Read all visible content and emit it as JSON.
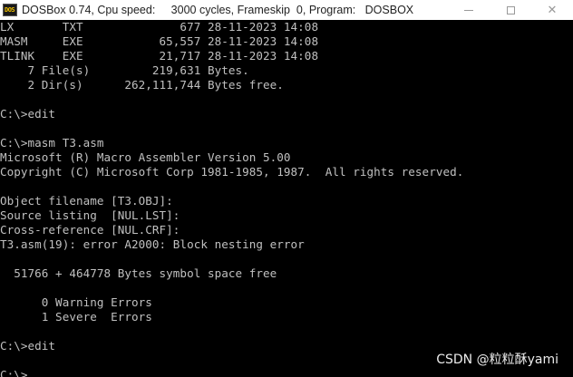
{
  "window": {
    "app_icon_label": "DOS",
    "title": "DOSBox 0.74, Cpu speed:     3000 cycles, Frameskip  0, Program:   DOSBOX",
    "controls": {
      "minimize": "minimize",
      "maximize": "maximize",
      "close": "✕"
    }
  },
  "console": {
    "lines": [
      "LX       TXT              677 28-11-2023 14:08",
      "MASM     EXE           65,557 28-11-2023 14:08",
      "TLINK    EXE           21,717 28-11-2023 14:08",
      "    7 File(s)         219,631 Bytes.",
      "    2 Dir(s)      262,111,744 Bytes free.",
      "",
      "C:\\>edit",
      "",
      "C:\\>masm T3.asm",
      "Microsoft (R) Macro Assembler Version 5.00",
      "Copyright (C) Microsoft Corp 1981-1985, 1987.  All rights reserved.",
      "",
      "Object filename [T3.OBJ]:",
      "Source listing  [NUL.LST]:",
      "Cross-reference [NUL.CRF]:",
      "T3.asm(19): error A2000: Block nesting error",
      "",
      "  51766 + 464778 Bytes symbol space free",
      "",
      "      0 Warning Errors",
      "      1 Severe  Errors",
      "",
      "C:\\>edit",
      "",
      "C:\\>"
    ]
  },
  "watermark": "CSDN @粒粒酥yami"
}
